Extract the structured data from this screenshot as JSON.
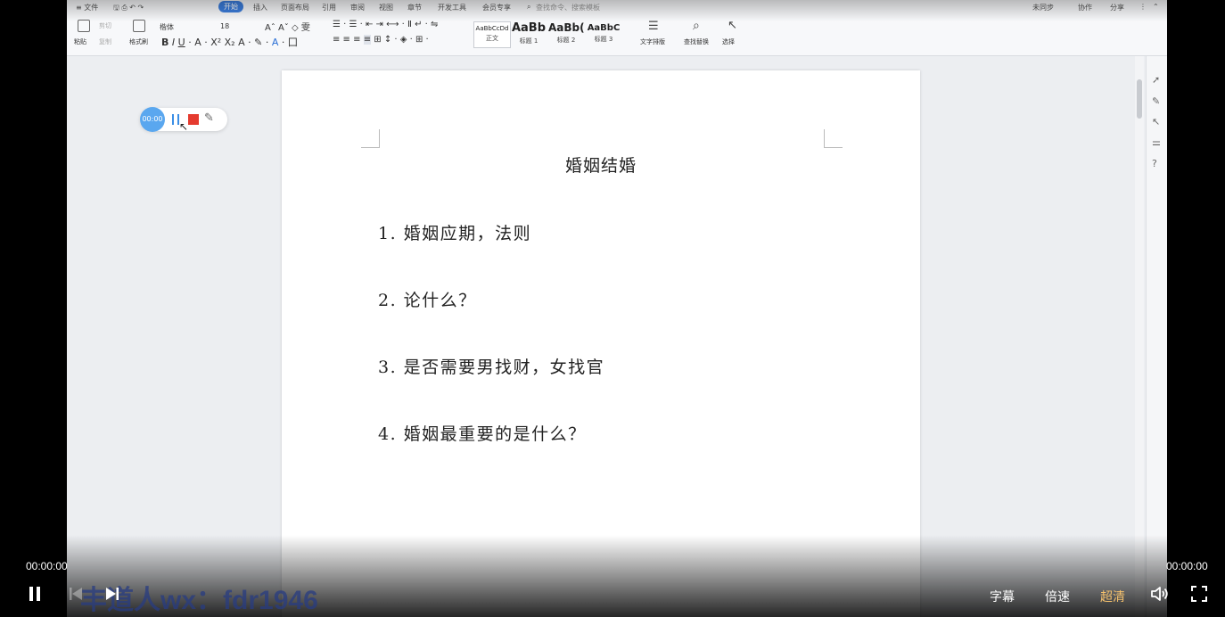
{
  "ribbon": {
    "tabs": [
      "≡ 文件",
      "开始",
      "插入",
      "页面布局",
      "引用",
      "审阅",
      "视图",
      "章节",
      "开发工具",
      "会员专享"
    ],
    "search_placeholder": "查找命令、搜索模板",
    "right": [
      "未同步",
      "协作",
      "分享"
    ],
    "paste": "粘贴",
    "cut": "剪切",
    "copy": "复制",
    "format_painter": "格式刷",
    "font_name": "楷体",
    "font_size": "18",
    "styles": [
      {
        "preview": "AaBbCcDd",
        "label": "正文"
      },
      {
        "preview": "AaBb",
        "label": "标题 1"
      },
      {
        "preview": "AaBb(",
        "label": "标题 2"
      },
      {
        "preview": "AaBbC",
        "label": "标题 3"
      }
    ],
    "text_layout": "文字排版",
    "find_replace": "查找替换",
    "select": "选择"
  },
  "recorder": {
    "time": "00:00"
  },
  "document": {
    "title": "婚姻结婚",
    "lines": [
      "1. 婚姻应期，法则",
      "2. 论什么？",
      "3. 是否需要男找财，女找官",
      "4. 婚姻最重要的是什么？"
    ]
  },
  "player": {
    "time_left": "00:00:00",
    "time_right": "00:00:00",
    "subtitle": "字幕",
    "speed": "倍速",
    "quality": "超清",
    "quality_color": "#f5c16c",
    "watermark": "丰道人wx：fdr1946"
  }
}
